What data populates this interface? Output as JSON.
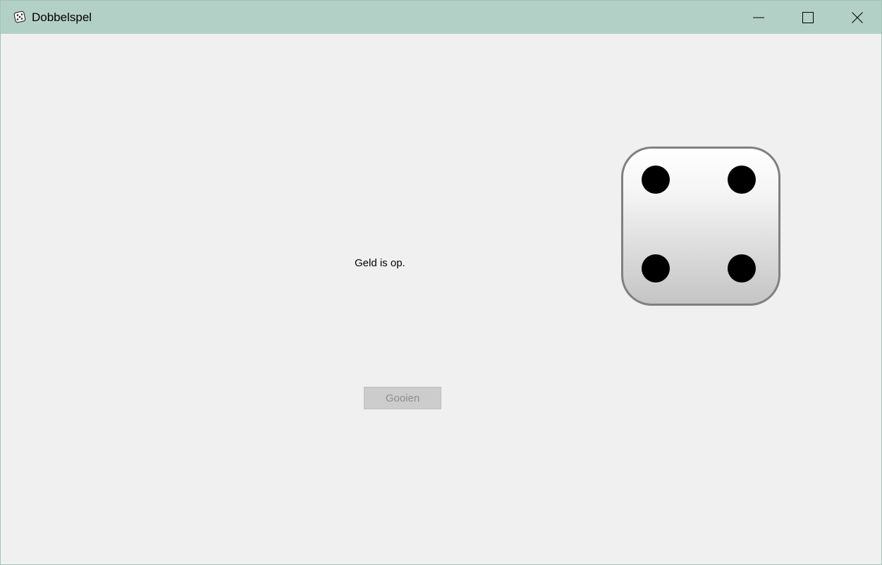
{
  "window": {
    "title": "Dobbelspel",
    "icon": "dice-icon",
    "controls": [
      "minimize-icon",
      "maximize-icon",
      "close-icon"
    ]
  },
  "main": {
    "status_text": "Geld is op.",
    "throw_button_label": "Gooien",
    "throw_button_enabled": false,
    "die_value": 4
  },
  "colors": {
    "titlebar": "#b3d0c7",
    "background": "#f0f0f0",
    "pip": "#000000",
    "die_border": "#808080"
  }
}
